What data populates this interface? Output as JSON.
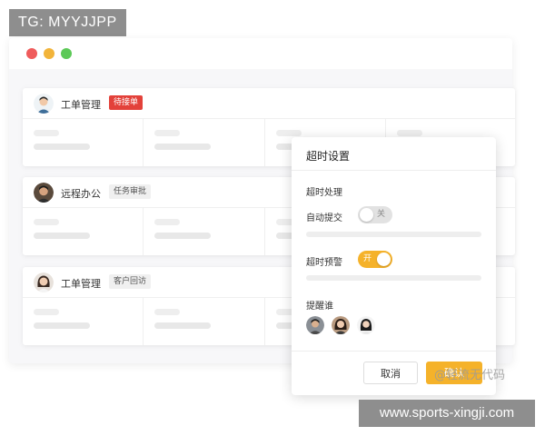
{
  "overlay": {
    "tg_label": "TG: MYYJJPP",
    "url_label": "www.sports-xingji.com",
    "watermark": "@轻流无代码"
  },
  "cards": [
    {
      "title": "工单管理",
      "tag": "待接单",
      "tag_style": "red"
    },
    {
      "title": "远程办公",
      "tag": "任务审批",
      "tag_style": "gray"
    },
    {
      "title": "工单管理",
      "tag": "客户回访",
      "tag_style": "gray"
    }
  ],
  "popup": {
    "title": "超时设置",
    "section_title": "超时处理",
    "auto_submit_label": "自动提交",
    "auto_submit_state": "关",
    "timeout_warning_label": "超时预警",
    "timeout_warning_state": "开",
    "remind_label": "提醒谁",
    "cancel_label": "取消",
    "confirm_label": "确认"
  },
  "colors": {
    "accent": "#f5b22a",
    "tag_red": "#e3413a",
    "window_red": "#ef5b5b",
    "window_yellow": "#f2b43a",
    "window_green": "#5cc957"
  }
}
